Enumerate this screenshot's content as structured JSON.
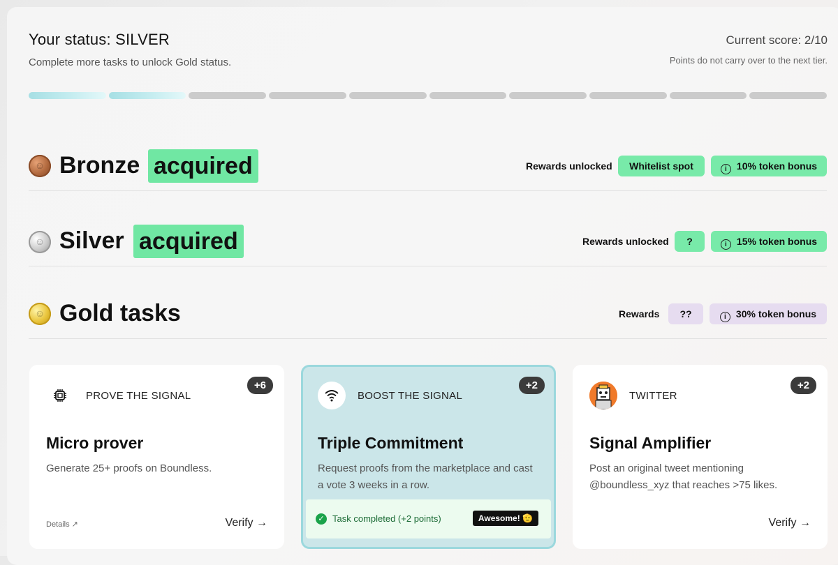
{
  "status": {
    "title": "Your status: SILVER",
    "subtitle": "Complete more tasks to unlock Gold status.",
    "score": "Current score: 2/10",
    "score_note": "Points do not carry over to the next tier.",
    "progress": {
      "filled": 2,
      "total": 10
    }
  },
  "tiers": [
    {
      "name": "Bronze",
      "state": "acquired",
      "rewards_label": "Rewards unlocked",
      "rewards": [
        "Whitelist spot",
        "10% token bonus"
      ],
      "coin_glyph": "☺"
    },
    {
      "name": "Silver",
      "state": "acquired",
      "rewards_label": "Rewards unlocked",
      "rewards": [
        "?",
        "15% token bonus"
      ],
      "coin_glyph": "☺"
    },
    {
      "name": "Gold tasks",
      "state": "",
      "rewards_label": "Rewards",
      "rewards": [
        "??",
        "30% token bonus"
      ],
      "coin_glyph": "☺"
    }
  ],
  "info_glyph": "i",
  "cards": [
    {
      "category": "PROVE THE SIGNAL",
      "points": "+6",
      "title": "Micro prover",
      "description": "Generate 25+ proofs on Boundless.",
      "details": "Details ↗",
      "verify": "Verify →",
      "icon": "chip-icon"
    },
    {
      "category": "BOOST THE SIGNAL",
      "points": "+2",
      "title": "Triple Commitment",
      "description": "Request proofs from the marketplace and cast a vote 3 weeks in a row.",
      "completed": "Task completed (+2 points)",
      "check": "✓",
      "awesome": "Awesome! 🫡",
      "icon": "wifi-icon"
    },
    {
      "category": "TWITTER",
      "points": "+2",
      "title": "Signal Amplifier",
      "description": "Post an original tweet mentioning @boundless_xyz that reaches >75 likes.",
      "verify": "Verify →",
      "icon": "avatar-icon"
    }
  ],
  "colors": {
    "acquired_green": "#70e7a3",
    "reward_green": "#78eaa9",
    "reward_purple": "#e6dcf0",
    "progress_fill": "#a6dfe4",
    "active_card": "#cbe6e9"
  }
}
